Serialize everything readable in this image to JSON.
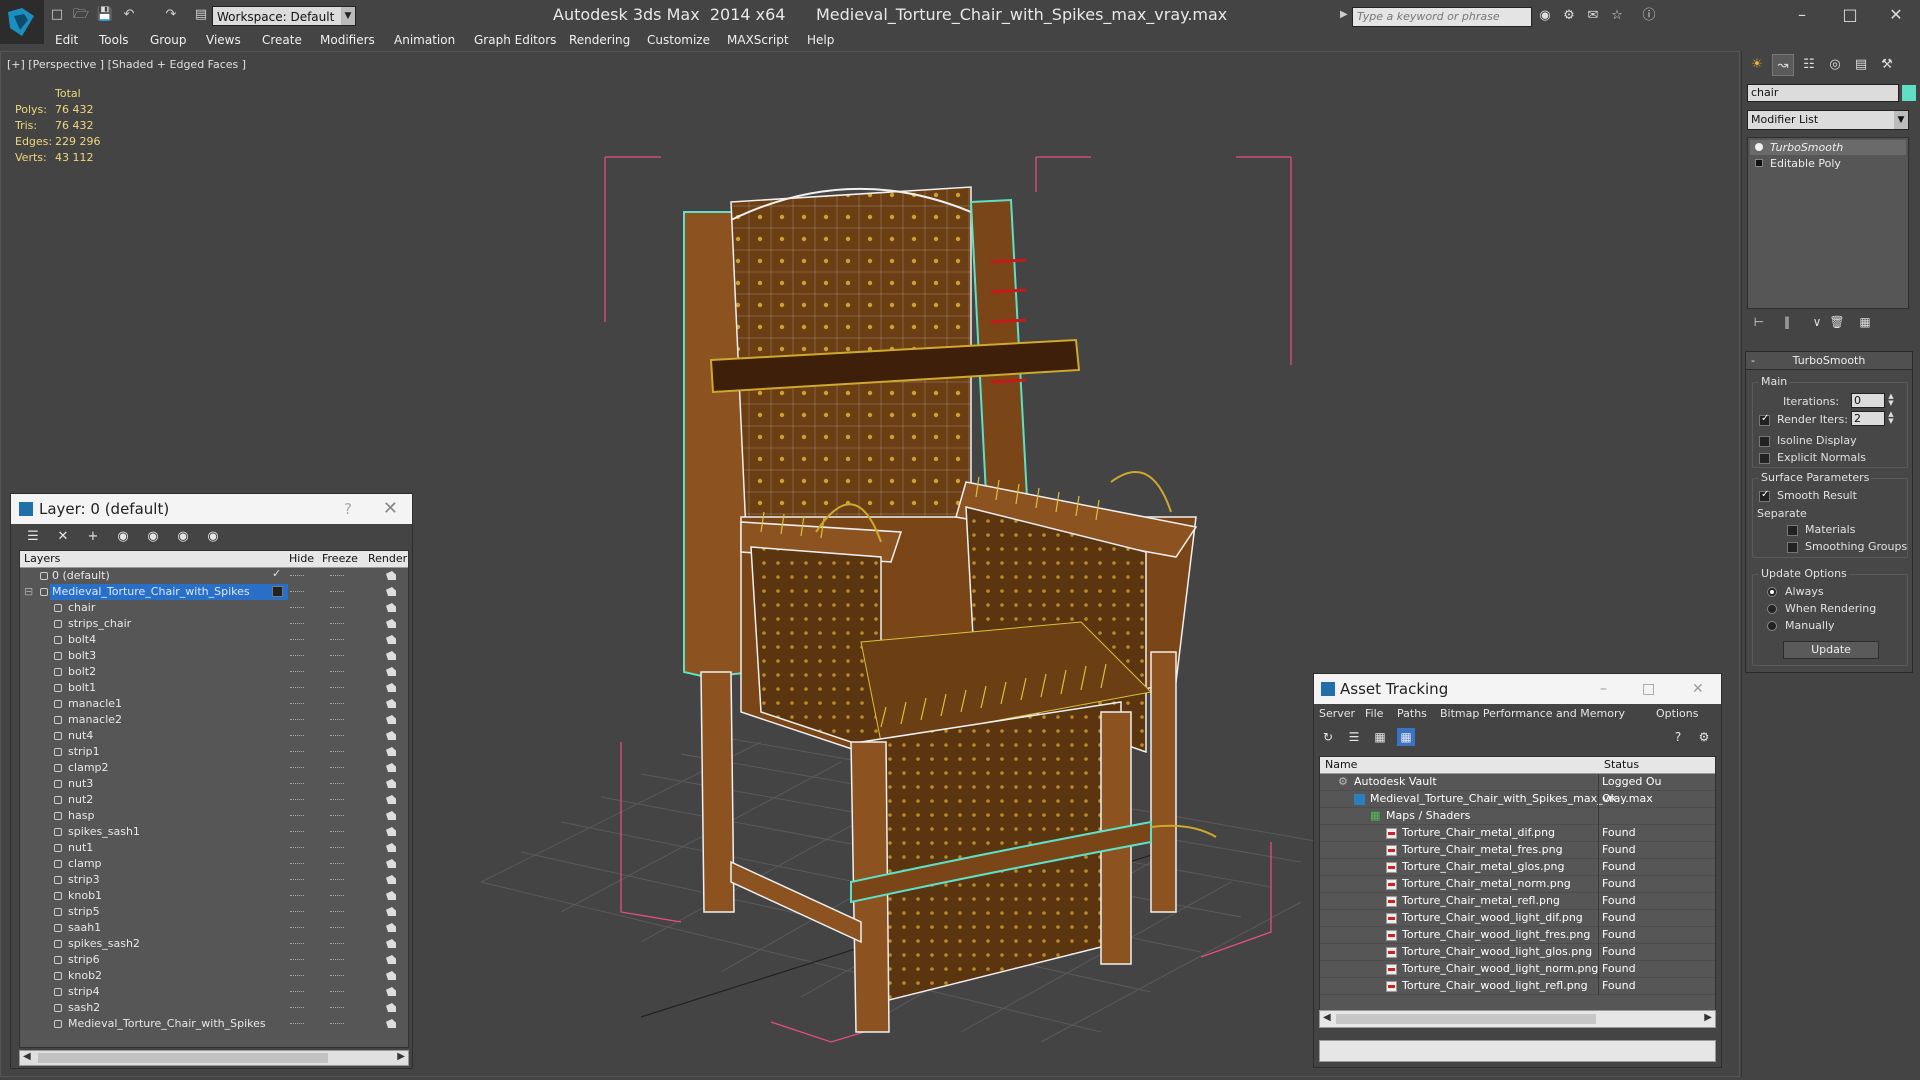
{
  "window": {
    "title": "Autodesk 3ds Max  2014 x64      Medieval_Torture_Chair_with_Spikes_max_vray.max",
    "workspace": "Workspace: Default",
    "search_placeholder": "Type a keyword or phrase"
  },
  "menu": [
    "Edit",
    "Tools",
    "Group",
    "Views",
    "Create",
    "Modifiers",
    "Animation",
    "Graph Editors",
    "Rendering",
    "Customize",
    "MAXScript",
    "Help"
  ],
  "viewport": {
    "label": "[+] [Perspective ] [Shaded + Edged Faces ]",
    "stats": {
      "header": "Total",
      "rows": [
        {
          "k": "Polys:",
          "v": "76 432"
        },
        {
          "k": "Tris:",
          "v": "76 432"
        },
        {
          "k": "Edges:",
          "v": "229 296"
        },
        {
          "k": "Verts:",
          "v": "43 112"
        }
      ]
    }
  },
  "layer_panel": {
    "title": "Layer: 0 (default)",
    "help": "?",
    "columns": {
      "layers": "Layers",
      "hide": "Hide",
      "freeze": "Freeze",
      "render": "Render"
    },
    "default_layer": "0 (default)",
    "main_layer": "Medieval_Torture_Chair_with_Spikes",
    "objects": [
      "chair",
      "strips_chair",
      "bolt4",
      "bolt3",
      "bolt2",
      "bolt1",
      "manacle1",
      "manacle2",
      "nut4",
      "strip1",
      "clamp2",
      "nut3",
      "nut2",
      "hasp",
      "spikes_sash1",
      "nut1",
      "clamp",
      "strip3",
      "knob1",
      "strip5",
      "saah1",
      "spikes_sash2",
      "strip6",
      "knob2",
      "strip4",
      "sash2",
      "Medieval_Torture_Chair_with_Spikes"
    ]
  },
  "asset_panel": {
    "title": "Asset Tracking",
    "menu": [
      "Server",
      "File",
      "Paths",
      "Bitmap Performance and Memory",
      "Options"
    ],
    "columns": {
      "name": "Name",
      "status": "Status"
    },
    "vault": {
      "name": "Autodesk Vault",
      "status": "Logged Ou"
    },
    "scene_file": {
      "name": "Medieval_Torture_Chair_with_Spikes_max_vray.max",
      "status": "Ok"
    },
    "maps_folder": "Maps / Shaders",
    "maps": [
      {
        "name": "Torture_Chair_metal_dif.png",
        "status": "Found"
      },
      {
        "name": "Torture_Chair_metal_fres.png",
        "status": "Found"
      },
      {
        "name": "Torture_Chair_metal_glos.png",
        "status": "Found"
      },
      {
        "name": "Torture_Chair_metal_norm.png",
        "status": "Found"
      },
      {
        "name": "Torture_Chair_metal_refl.png",
        "status": "Found"
      },
      {
        "name": "Torture_Chair_wood_light_dif.png",
        "status": "Found"
      },
      {
        "name": "Torture_Chair_wood_light_fres.png",
        "status": "Found"
      },
      {
        "name": "Torture_Chair_wood_light_glos.png",
        "status": "Found"
      },
      {
        "name": "Torture_Chair_wood_light_norm.png",
        "status": "Found"
      },
      {
        "name": "Torture_Chair_wood_light_refl.png",
        "status": "Found"
      }
    ]
  },
  "command_panel": {
    "object_name": "chair",
    "object_color": "#5fe0c6",
    "modifier_list": "Modifier List",
    "stack": [
      "TurboSmooth",
      "Editable Poly"
    ],
    "turbosmooth": {
      "title": "TurboSmooth",
      "main_label": "Main",
      "iterations_label": "Iterations:",
      "iterations": "0",
      "render_iters_label": "Render Iters:",
      "render_iters": "2",
      "isoline": "Isoline Display",
      "explicit_normals": "Explicit Normals",
      "surface_label": "Surface Parameters",
      "smooth_result": "Smooth Result",
      "separate_label": "Separate",
      "materials": "Materials",
      "smoothing_groups": "Smoothing Groups",
      "update_label": "Update Options",
      "always": "Always",
      "when_rendering": "When Rendering",
      "manually": "Manually",
      "update_button": "Update"
    }
  }
}
